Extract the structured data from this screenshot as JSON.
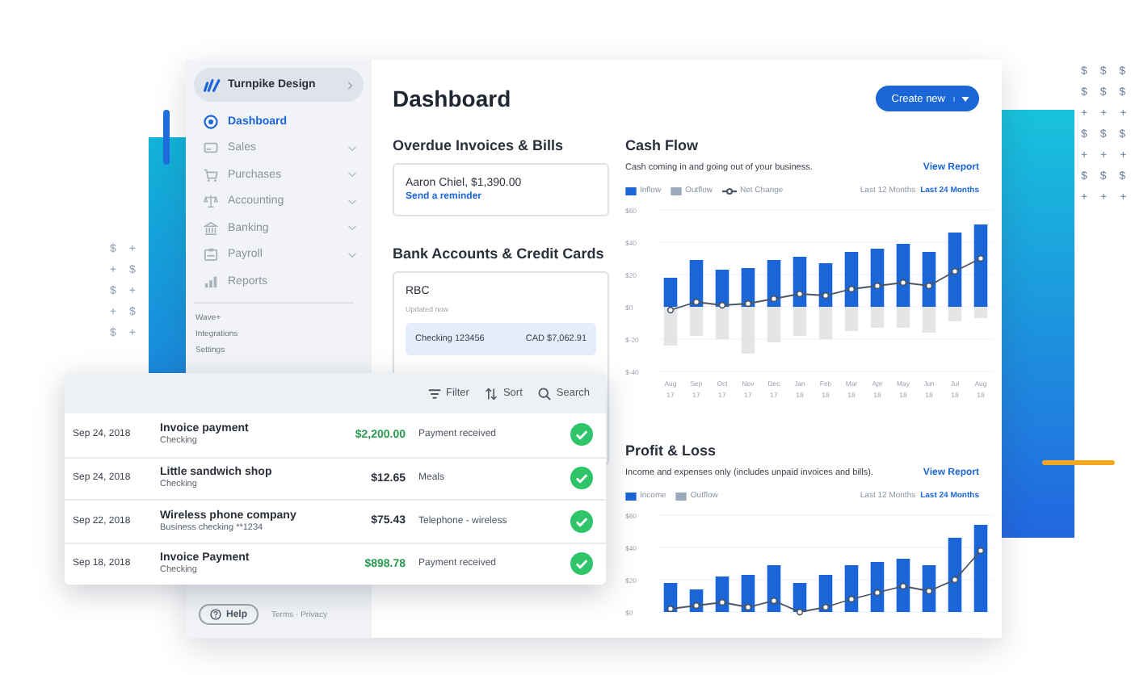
{
  "decor": {
    "right_rows": [
      "$ $ $",
      "$ $ $",
      "+ + +",
      "$ $ $",
      "+ + +",
      "$ $ $",
      "+ + +"
    ],
    "left_rows": [
      "$ +",
      "+ $",
      "$ +",
      "+ $",
      "$ +"
    ]
  },
  "sidebar": {
    "company": "Turnpike Design",
    "items": [
      {
        "label": "Dashboard",
        "selected": true,
        "expandable": false
      },
      {
        "label": "Sales",
        "selected": false,
        "expandable": true
      },
      {
        "label": "Purchases",
        "selected": false,
        "expandable": true
      },
      {
        "label": "Accounting",
        "selected": false,
        "expandable": true
      },
      {
        "label": "Banking",
        "selected": false,
        "expandable": true
      },
      {
        "label": "Payroll",
        "selected": false,
        "expandable": true
      },
      {
        "label": "Reports",
        "selected": false,
        "expandable": false
      }
    ],
    "links": [
      "Wave+",
      "Integrations",
      "Settings"
    ],
    "help": "Help",
    "footer": "Terms · Privacy"
  },
  "header": {
    "title": "Dashboard",
    "button": "Create new"
  },
  "overdue": {
    "title": "Overdue Invoices & Bills",
    "text": "Aaron Chiel, $1,390.00",
    "link": "Send a reminder"
  },
  "bank": {
    "title": "Bank Accounts & Credit Cards",
    "name": "RBC",
    "updated": "Updated now",
    "accounts": [
      {
        "name": "Checking 123456",
        "balance": "CAD $7,062.91"
      }
    ]
  },
  "cash_flow": {
    "title": "Cash Flow",
    "description": "Cash coming in and going out of your business.",
    "link": "View Report",
    "legend": [
      {
        "label": "Inflow",
        "kind": "bar",
        "color": "#1b66d6"
      },
      {
        "label": "Outflow",
        "kind": "bar",
        "color": "#9aa9bb"
      },
      {
        "label": "Net Change",
        "kind": "line",
        "color": "#4b5563"
      }
    ],
    "ranges": [
      {
        "label": "Last 12 Months",
        "selected": false
      },
      {
        "label": "Last 24 Months",
        "selected": true
      }
    ],
    "chart_data": {
      "type": "bar",
      "stacked": true,
      "grid": true,
      "categories": [
        "Aug 17",
        "Sep 17",
        "Oct 17",
        "Nov 17",
        "Dec 17",
        "Jan 18",
        "Feb 18",
        "Mar 18",
        "Apr 18",
        "May 18",
        "Jun 18",
        "Jul 18",
        "Aug 18"
      ],
      "ylim": [
        -40,
        60
      ],
      "yticks": [
        {
          "value": -40,
          "label": "$-40"
        },
        {
          "value": -20,
          "label": "$-20"
        },
        {
          "value": 0,
          "label": "$0"
        },
        {
          "value": 20,
          "label": "$20"
        },
        {
          "value": 40,
          "label": "$40"
        },
        {
          "value": 60,
          "label": "$60"
        }
      ],
      "series": [
        {
          "type": "bar",
          "color": "#1b66d6",
          "values": [
            18,
            29,
            23,
            24,
            29,
            31,
            27,
            34,
            36,
            39,
            34,
            46,
            51
          ]
        },
        {
          "type": "bar",
          "color": "#e4e5e7",
          "values": [
            -24,
            -18,
            -20,
            -29,
            -22,
            -18,
            -20,
            -15,
            -13,
            -13,
            -16,
            -9,
            -7
          ]
        },
        {
          "type": "line",
          "marker": true,
          "color": "#4b5563",
          "values": [
            -2,
            3,
            1,
            2,
            5,
            8,
            7,
            11,
            13,
            15,
            13,
            22,
            30
          ]
        }
      ]
    }
  },
  "profit_loss": {
    "title": "Profit & Loss",
    "description": "Income and expenses only (includes unpaid invoices and bills).",
    "link": "View Report",
    "legend": [
      {
        "label": "Income",
        "kind": "bar",
        "color": "#1b66d6"
      },
      {
        "label": "Outflow",
        "kind": "bar",
        "color": "#9aa9bb"
      }
    ],
    "ranges": [
      {
        "label": "Last 12 Months",
        "selected": false
      },
      {
        "label": "Last 24 Months",
        "selected": true
      }
    ],
    "chart_data": {
      "type": "bar",
      "grid": true,
      "ylim": [
        0,
        60
      ],
      "yticks": [
        {
          "value": 0,
          "label": "$0"
        },
        {
          "value": 20,
          "label": "$20"
        },
        {
          "value": 40,
          "label": "$40"
        },
        {
          "value": 60,
          "label": "$60"
        }
      ],
      "series": [
        {
          "type": "bar",
          "color": "#1b66d6",
          "values": [
            18,
            14,
            22,
            23,
            29,
            18,
            23,
            29,
            31,
            33,
            29,
            46,
            54
          ]
        },
        {
          "type": "line",
          "marker": true,
          "color": "#4b5563",
          "values": [
            2,
            4,
            6,
            3,
            7,
            0,
            3,
            8,
            12,
            16,
            13,
            20,
            38
          ]
        }
      ]
    }
  },
  "transactions": {
    "tools": [
      {
        "label": "Filter"
      },
      {
        "label": "Sort"
      },
      {
        "label": "Search"
      }
    ],
    "rows": [
      {
        "date": "Sep 24, 2018",
        "name": "Invoice payment",
        "account": "Checking",
        "amount": "$2,200.00",
        "positive": true,
        "category": "Payment received"
      },
      {
        "date": "Sep 24, 2018",
        "name": "Little sandwich shop",
        "account": "Checking",
        "amount": "$12.65",
        "positive": false,
        "category": "Meals"
      },
      {
        "date": "Sep 22, 2018",
        "name": "Wireless phone company",
        "account": "Business checking **1234",
        "amount": "$75.43",
        "positive": false,
        "category": "Telephone - wireless"
      },
      {
        "date": "Sep 18, 2018",
        "name": "Invoice Payment",
        "account": "Checking",
        "amount": "$898.78",
        "positive": true,
        "category": "Payment received"
      }
    ]
  }
}
